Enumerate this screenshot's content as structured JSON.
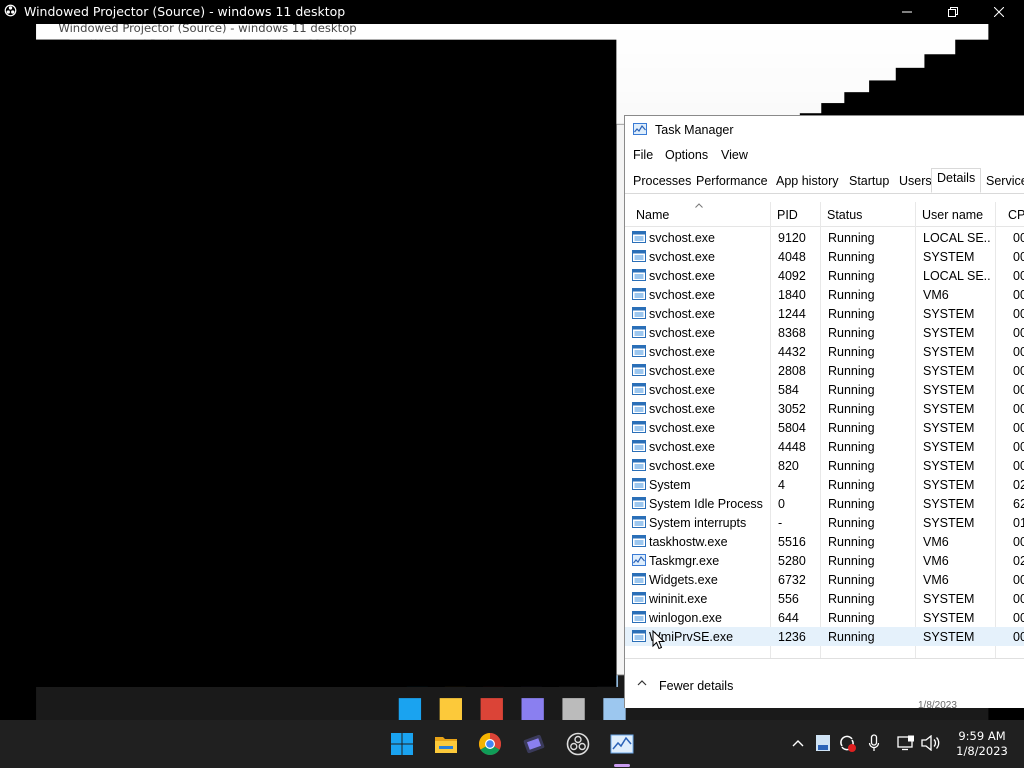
{
  "projector": {
    "title": "Windowed Projector (Source) - windows 11 desktop",
    "minimize_icon": "minimize-icon",
    "restore_icon": "restore-icon",
    "close_icon": "close-icon"
  },
  "task_manager": {
    "title": "Task Manager",
    "menu": [
      "File",
      "Options",
      "View"
    ],
    "tabs": [
      "Processes",
      "Performance",
      "App history",
      "Startup",
      "Users",
      "Details",
      "Service"
    ],
    "active_tab": "Details",
    "columns": [
      "Name",
      "PID",
      "Status",
      "User name",
      "CPU"
    ],
    "rows": [
      {
        "name": "svchost.exe",
        "pid": "9120",
        "status": "Running",
        "user": "LOCAL SE...",
        "cpu": "00"
      },
      {
        "name": "svchost.exe",
        "pid": "4048",
        "status": "Running",
        "user": "SYSTEM",
        "cpu": "00"
      },
      {
        "name": "svchost.exe",
        "pid": "4092",
        "status": "Running",
        "user": "LOCAL SE...",
        "cpu": "00"
      },
      {
        "name": "svchost.exe",
        "pid": "1840",
        "status": "Running",
        "user": "VM6",
        "cpu": "00"
      },
      {
        "name": "svchost.exe",
        "pid": "1244",
        "status": "Running",
        "user": "SYSTEM",
        "cpu": "00"
      },
      {
        "name": "svchost.exe",
        "pid": "8368",
        "status": "Running",
        "user": "SYSTEM",
        "cpu": "00"
      },
      {
        "name": "svchost.exe",
        "pid": "4432",
        "status": "Running",
        "user": "SYSTEM",
        "cpu": "00"
      },
      {
        "name": "svchost.exe",
        "pid": "2808",
        "status": "Running",
        "user": "SYSTEM",
        "cpu": "00"
      },
      {
        "name": "svchost.exe",
        "pid": "584",
        "status": "Running",
        "user": "SYSTEM",
        "cpu": "00"
      },
      {
        "name": "svchost.exe",
        "pid": "3052",
        "status": "Running",
        "user": "SYSTEM",
        "cpu": "00"
      },
      {
        "name": "svchost.exe",
        "pid": "5804",
        "status": "Running",
        "user": "SYSTEM",
        "cpu": "00"
      },
      {
        "name": "svchost.exe",
        "pid": "4448",
        "status": "Running",
        "user": "SYSTEM",
        "cpu": "00"
      },
      {
        "name": "svchost.exe",
        "pid": "820",
        "status": "Running",
        "user": "SYSTEM",
        "cpu": "00"
      },
      {
        "name": "System",
        "pid": "4",
        "status": "Running",
        "user": "SYSTEM",
        "cpu": "02"
      },
      {
        "name": "System Idle Process",
        "pid": "0",
        "status": "Running",
        "user": "SYSTEM",
        "cpu": "62"
      },
      {
        "name": "System interrupts",
        "pid": "-",
        "status": "Running",
        "user": "SYSTEM",
        "cpu": "01"
      },
      {
        "name": "taskhostw.exe",
        "pid": "5516",
        "status": "Running",
        "user": "VM6",
        "cpu": "00"
      },
      {
        "name": "Taskmgr.exe",
        "pid": "5280",
        "status": "Running",
        "user": "VM6",
        "cpu": "02"
      },
      {
        "name": "Widgets.exe",
        "pid": "6732",
        "status": "Running",
        "user": "VM6",
        "cpu": "00"
      },
      {
        "name": "wininit.exe",
        "pid": "556",
        "status": "Running",
        "user": "SYSTEM",
        "cpu": "00"
      },
      {
        "name": "winlogon.exe",
        "pid": "644",
        "status": "Running",
        "user": "SYSTEM",
        "cpu": "00"
      },
      {
        "name": "WmiPrvSE.exe",
        "pid": "1236",
        "status": "Running",
        "user": "SYSTEM",
        "cpu": "00"
      }
    ],
    "selected_row": 21,
    "footer_label": "Fewer details"
  },
  "taskbar": {
    "icons": [
      "windows-start-icon",
      "file-explorer-icon",
      "chrome-icon",
      "video-editor-icon",
      "obs-icon",
      "task-manager-icon"
    ],
    "tray_icons": [
      "chevron-up-icon",
      "network-adapter-icon",
      "sync-icon",
      "microphone-icon",
      "display-icon",
      "volume-icon"
    ],
    "time": "9:59 AM",
    "date": "1/8/2023",
    "ghost_date": "1/8/2023"
  },
  "colors": {
    "taskbar": "#202020",
    "selection": "#e5f1fb",
    "accent": "#0078d4"
  }
}
